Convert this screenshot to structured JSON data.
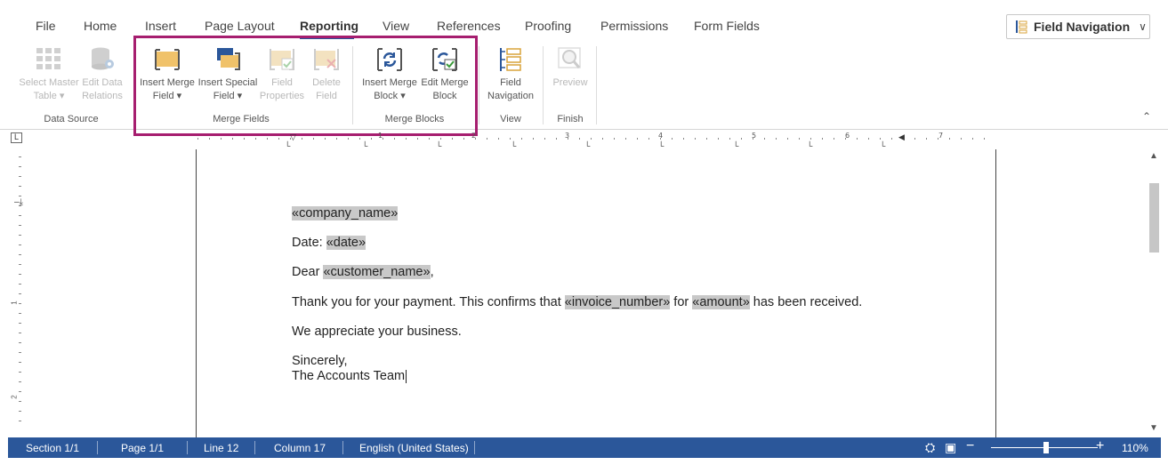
{
  "tabs": {
    "items": [
      "File",
      "Home",
      "Insert",
      "Page Layout",
      "Reporting",
      "View",
      "References",
      "Proofing",
      "Permissions",
      "Form Fields"
    ],
    "active": "Reporting"
  },
  "field_navigation_dropdown": {
    "label": "Field Navigation"
  },
  "ribbon": {
    "select_master_table": [
      "Select Master",
      "Table ▾"
    ],
    "edit_data_relations": [
      "Edit Data",
      "Relations"
    ],
    "insert_merge_field": [
      "Insert Merge",
      "Field ▾"
    ],
    "insert_special_field": [
      "Insert Special",
      "Field ▾"
    ],
    "field_properties": [
      "Field",
      "Properties"
    ],
    "delete_field": [
      "Delete",
      "Field"
    ],
    "insert_merge_block": [
      "Insert Merge",
      "Block ▾"
    ],
    "edit_merge_block": [
      "Edit Merge",
      "Block"
    ],
    "field_navigation": [
      "Field",
      "Navigation"
    ],
    "preview": [
      "Preview"
    ],
    "groups": {
      "data_source": "Data Source",
      "merge_fields": "Merge Fields",
      "merge_blocks": "Merge Blocks",
      "view": "View",
      "finish": "Finish"
    }
  },
  "ruler": {
    "corner": "L",
    "numbers": [
      "1",
      "2",
      "3",
      "4",
      "5",
      "6",
      "7"
    ],
    "vnumbers": [
      "1",
      "2"
    ]
  },
  "document": {
    "line1_field": "«company_name»",
    "line2_prefix": "Date: ",
    "line2_field": "«date»",
    "line3_prefix": "Dear ",
    "line3_field": "«customer_name»",
    "line3_suffix": ",",
    "line4_a": "Thank you for your payment. This confirms that ",
    "line4_field1": "«invoice_number»",
    "line4_b": " for ",
    "line4_field2": "«amount»",
    "line4_c": " has been received.",
    "line5": "We appreciate your business.",
    "line6": "Sincerely,",
    "line7": "The Accounts Team"
  },
  "status": {
    "section": "Section 1/1",
    "page": "Page 1/1",
    "line": "Line 12",
    "column": "Column 17",
    "language": "English (United States)",
    "zoom": "110%",
    "zoom_minus": "−",
    "zoom_plus": "+"
  }
}
